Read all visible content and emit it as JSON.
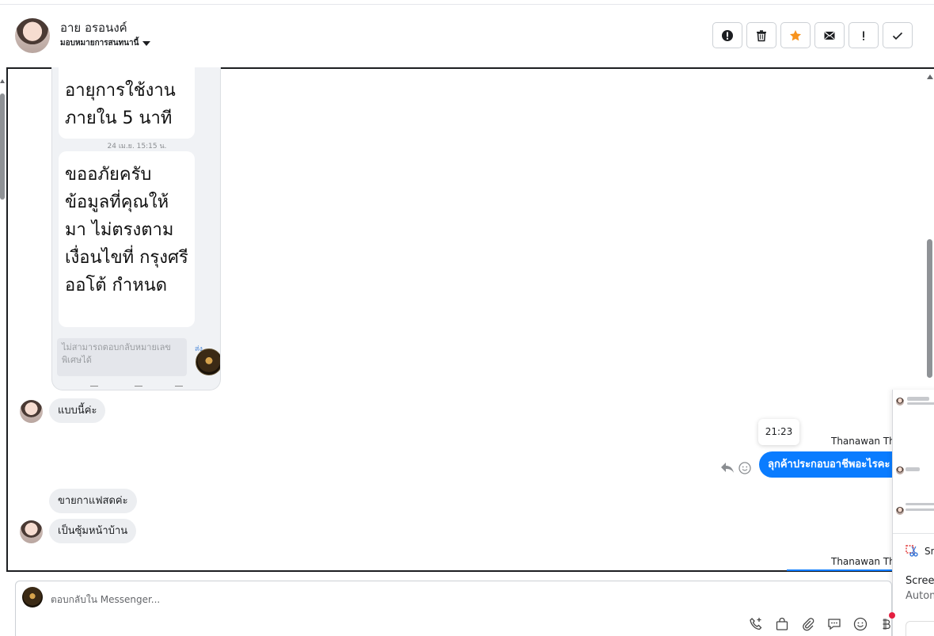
{
  "header": {
    "contact_name": "อาย อรอนงค์",
    "assign_label": "มอบหมายการสนทนานี้",
    "actions": [
      "spam-report",
      "delete",
      "star",
      "mark-unread",
      "follow-up",
      "done"
    ],
    "star_color": "#f7931e"
  },
  "screenshot_card": {
    "bubble_1": "อายุการใช้งาน ภายใน 5 นาที",
    "timestamp": "24 เม.ย. 15:15 น.",
    "bubble_2": "ขออภัยครับ ข้อมูลที่คุณให้มา ไม่ตรงตามเงื่อนไขที่ กรุงศรี ออโต้ กำหนด",
    "input_placeholder": "ไม่สามารถตอบกลับหมายเลขพิเศษได้",
    "send_label": "ส่ง"
  },
  "messages": {
    "incoming_1": "แบบนี้ค่ะ",
    "tooltip_time": "21:23",
    "sender_name": "Thanawan Tho",
    "outgoing_1": "ลุกค้าประกอบอาชีพอะไรคะ",
    "incoming_2": "ขายกาแฟสดค่ะ",
    "incoming_3": "เป็นซุ้มหน้าบ้าน",
    "sender_name_2": "Thanawan Tho",
    "outgoing_color": "#0a7cff"
  },
  "popup": {
    "snip_label": "Sn",
    "line_1": "Screen",
    "line_2": "Autom"
  },
  "composer": {
    "placeholder": "ตอบกลับใน Messenger..."
  }
}
